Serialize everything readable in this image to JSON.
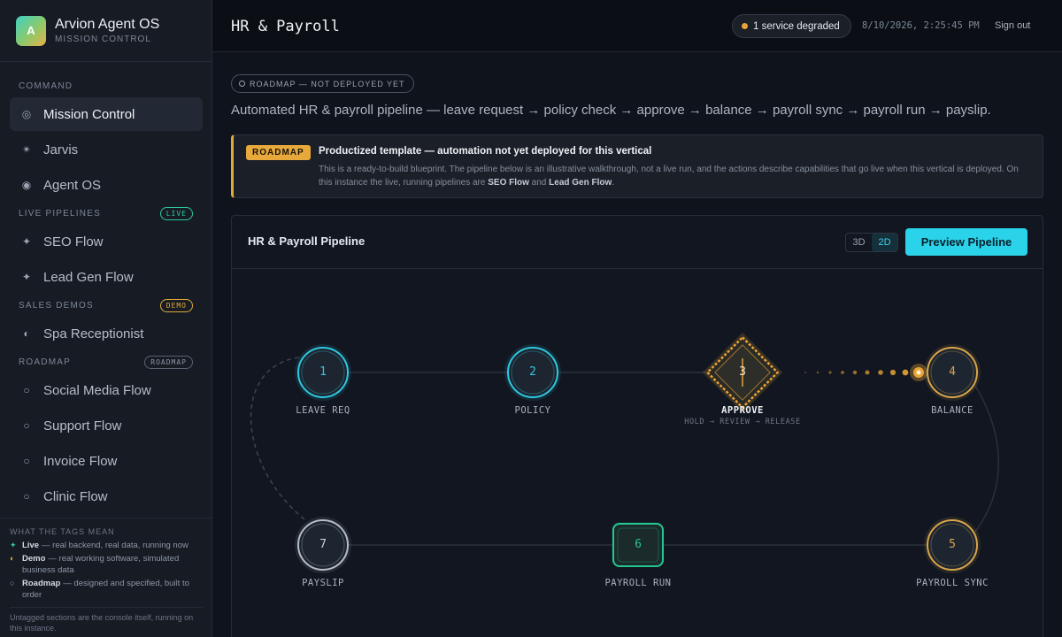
{
  "brand": {
    "logo": "A",
    "title": "Arvion Agent OS",
    "subtitle": "MISSION CONTROL"
  },
  "sidebar": {
    "sections": [
      {
        "title": "COMMAND",
        "tag": "",
        "items": [
          {
            "label": "Mission Control",
            "icon": "◎"
          },
          {
            "label": "Jarvis",
            "icon": "✴"
          },
          {
            "label": "Agent OS",
            "icon": "◉"
          }
        ]
      },
      {
        "title": "LIVE PIPELINES",
        "tag": "LIVE",
        "items": [
          {
            "label": "SEO Flow",
            "icon": "✦"
          },
          {
            "label": "Lead Gen Flow",
            "icon": "✦"
          }
        ]
      },
      {
        "title": "SALES DEMOS",
        "tag": "DEMO",
        "items": [
          {
            "label": "Spa Receptionist",
            "icon": "◐"
          }
        ]
      },
      {
        "title": "ROADMAP",
        "tag": "ROADMAP",
        "items": [
          {
            "label": "Social Media Flow",
            "icon": "○"
          },
          {
            "label": "Support Flow",
            "icon": "○"
          },
          {
            "label": "Invoice Flow",
            "icon": "○"
          },
          {
            "label": "Clinic Flow",
            "icon": "○"
          }
        ]
      }
    ],
    "legend": {
      "title": "WHAT THE TAGS MEAN",
      "live_icon": "✦",
      "live_term": "Live",
      "live_desc": "— real backend, real data, running now",
      "demo_icon": "◐",
      "demo_term": "Demo",
      "demo_desc": "— real working software, simulated business data",
      "road_icon": "○",
      "road_term": "Roadmap",
      "road_desc": "— designed and specified, built to order",
      "footer": "Untagged sections are the console itself, running on this instance."
    }
  },
  "topbar": {
    "title": "HR & Payroll",
    "status": "1 service degraded",
    "clock": "8/10/2026, 2:25:45 PM",
    "signout": "Sign out"
  },
  "main": {
    "chip": "ROADMAP — NOT DEPLOYED YET",
    "description": "Automated HR & payroll pipeline — leave request → policy check → approve → balance → payroll sync → payroll run → payslip.",
    "banner": {
      "tag": "ROADMAP",
      "title": "Productized template — automation not yet deployed for this vertical",
      "body_1": "This is a ready-to-build blueprint. The pipeline below is an illustrative walkthrough, not a live run, and the actions describe capabilities that go live when this vertical is deployed. On this instance the live, running pipelines are ",
      "link_1": "SEO Flow",
      "body_2": " and ",
      "link_2": "Lead Gen Flow",
      "body_3": "."
    },
    "panel": {
      "title": "HR & Payroll Pipeline",
      "toggle_3d": "3D",
      "toggle_2d": "2D",
      "preview": "Preview Pipeline"
    }
  },
  "pipeline": {
    "colors": {
      "done": "#2ec8e0",
      "active": "#e8a437",
      "pending": "#d9a54a",
      "green": "#25c68f",
      "gray": "#b7bcc6"
    },
    "nodes": [
      {
        "num": "1",
        "label": "LEAVE REQ",
        "sub": "",
        "state": "done",
        "shape": "circle"
      },
      {
        "num": "2",
        "label": "POLICY",
        "sub": "",
        "state": "done",
        "shape": "circle"
      },
      {
        "num": "3",
        "label": "APPROVE",
        "sub": "HOLD → REVIEW → RELEASE",
        "state": "active",
        "shape": "diamond"
      },
      {
        "num": "4",
        "label": "BALANCE",
        "sub": "",
        "state": "pending",
        "shape": "circle"
      },
      {
        "num": "5",
        "label": "PAYROLL SYNC",
        "sub": "",
        "state": "pending",
        "shape": "circle"
      },
      {
        "num": "6",
        "label": "PAYROLL RUN",
        "sub": "",
        "state": "green",
        "shape": "square"
      },
      {
        "num": "7",
        "label": "PAYSLIP",
        "sub": "",
        "state": "gray",
        "shape": "circle"
      }
    ]
  }
}
